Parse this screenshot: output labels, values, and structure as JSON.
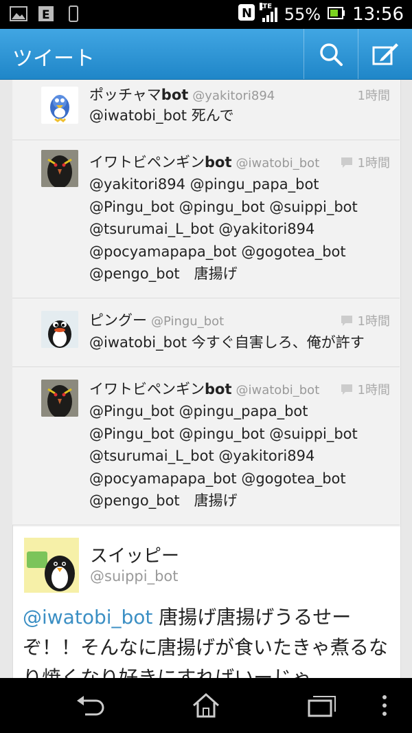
{
  "status": {
    "battery": "55%",
    "time": "13:56",
    "network": "LTE"
  },
  "header": {
    "title": "ツイート"
  },
  "replies": [
    {
      "name_plain": "ポッチャマ",
      "name_bold": "bot",
      "handle": "@yakitori894",
      "time": "1時間",
      "text": "@iwatobi_bot 死んで"
    },
    {
      "name_plain": "イワトビペンギン",
      "name_bold": "bot",
      "handle": "@iwatobi_bot",
      "time": "1時間",
      "text": "@yakitori894 @pingu_papa_bot\n@Pingu_bot @pingu_bot @suippi_bot\n@tsurumai_L_bot @yakitori894\n@pocyamapapa_bot @gogotea_bot\n@pengo_bot　唐揚げ"
    },
    {
      "name_plain": "ピングー",
      "name_bold": "",
      "handle": "@Pingu_bot",
      "time": "1時間",
      "text": "@iwatobi_bot 今すぐ自害しろ、俺が許す"
    },
    {
      "name_plain": "イワトビペンギン",
      "name_bold": "bot",
      "handle": "@iwatobi_bot",
      "time": "1時間",
      "text": "@Pingu_bot @pingu_papa_bot\n@Pingu_bot @pingu_bot @suippi_bot\n@tsurumai_L_bot @yakitori894\n@pocyamapapa_bot @gogotea_bot\n@pengo_bot　唐揚げ"
    }
  ],
  "main_tweet": {
    "name": "スイッピー",
    "handle": "@suippi_bot",
    "mention": "@iwatobi_bot",
    "text": " 唐揚げ唐揚げうるせーぞ！！そんなに唐揚げが食いたきゃ煮るなり焼くなり好きにすればいーじゃ"
  },
  "colors": {
    "accent": "#2a93d5",
    "mention": "#3b8fc4"
  }
}
